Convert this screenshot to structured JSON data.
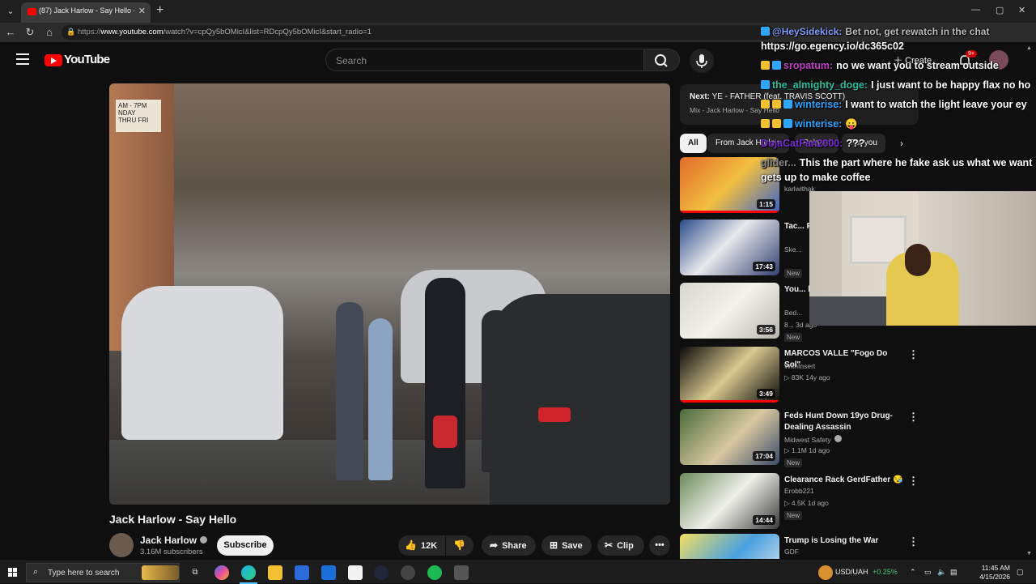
{
  "browser": {
    "tab_title": "(87) Jack Harlow - Say Hello - You",
    "url_prefix": "https://",
    "url_host": "www.youtube.com",
    "url_path": "/watch?v=cpQy5bOMicI&list=RDcpQy5bOMicI&start_radio=1"
  },
  "header": {
    "logo": "YouTube",
    "search_placeholder": "Search",
    "create_label": "Create",
    "notification_count": "9+"
  },
  "video": {
    "title": "Jack Harlow - Say Hello",
    "channel": "Jack Harlow",
    "subscribers": "3.16M subscribers",
    "subscribe_label": "Subscribe",
    "likes": "12K",
    "share_label": "Share",
    "save_label": "Save",
    "clip_label": "Clip",
    "scene_sign_text": "AM - 7PM\nNDAY\nTHRU FRI"
  },
  "sidebar": {
    "next_prefix": "Next:",
    "next_title": "YE - FATHER (feat. TRAVIS SCOTT)",
    "next_sub": "Mix - Jack Harlow - Say Hello",
    "chips": [
      "All",
      "From Jack Harlow",
      "Related",
      "For you"
    ],
    "items": [
      {
        "title": "",
        "channel": "karlwithak",
        "meta": "",
        "new": "",
        "duration": "1:15",
        "progress": 1.0
      },
      {
        "title": "Tac... File...",
        "channel": "Ske...",
        "meta": "",
        "new": "New",
        "duration": "17:43",
        "progress": 0
      },
      {
        "title": "You... bed...",
        "channel": "Bed...",
        "meta": "8... 3d ago",
        "new": "New",
        "duration": "3:56",
        "progress": 0
      },
      {
        "title": "MARCOS VALLE \"Fogo Do Sol\"",
        "channel": "WithInsert",
        "meta": "83K  14y ago",
        "new": "",
        "duration": "3:49",
        "progress": 1.0
      },
      {
        "title": "Feds Hunt Down 19yo Drug-Dealing Assassin",
        "channel": "Midwest Safety",
        "meta": "1.1M  1d ago",
        "new": "New",
        "duration": "17:04",
        "progress": 0
      },
      {
        "title": "Clearance Rack GerdFather",
        "channel": "Erobb221",
        "meta": "4.5K  1d ago",
        "new": "New",
        "duration": "14:44",
        "progress": 0
      },
      {
        "title": "Trump is Losing the War",
        "channel": "GDF",
        "meta": "",
        "new": "",
        "duration": "",
        "progress": 0
      }
    ]
  },
  "chat": {
    "lines": [
      {
        "user": "@HeySidekick:",
        "text": "Bet not, get rewatch in the chat"
      },
      {
        "user": "",
        "text": "https://go.egency.io/dc365c02"
      },
      {
        "user": "sropatum:",
        "text": "no we want you to stream outside"
      },
      {
        "user": "the_almighty_doge:",
        "text": "I just want to be happy flax no ho"
      },
      {
        "user": "winterise:",
        "text": "I want to watch the light leave your ey"
      },
      {
        "user": "winterise:",
        "text": "😛"
      },
      {
        "user": "DojaCatFan2000:",
        "text": "???"
      },
      {
        "user": "glider...",
        "text": "This the part where he fake ask us what we want"
      },
      {
        "user": "",
        "text": "gets up to make coffee"
      }
    ]
  },
  "taskbar": {
    "search_placeholder": "Type here to search",
    "currency": "USD/UAH",
    "currency_change": "+0.25%",
    "time": "11:45 AM",
    "date": "4/15/2026"
  }
}
